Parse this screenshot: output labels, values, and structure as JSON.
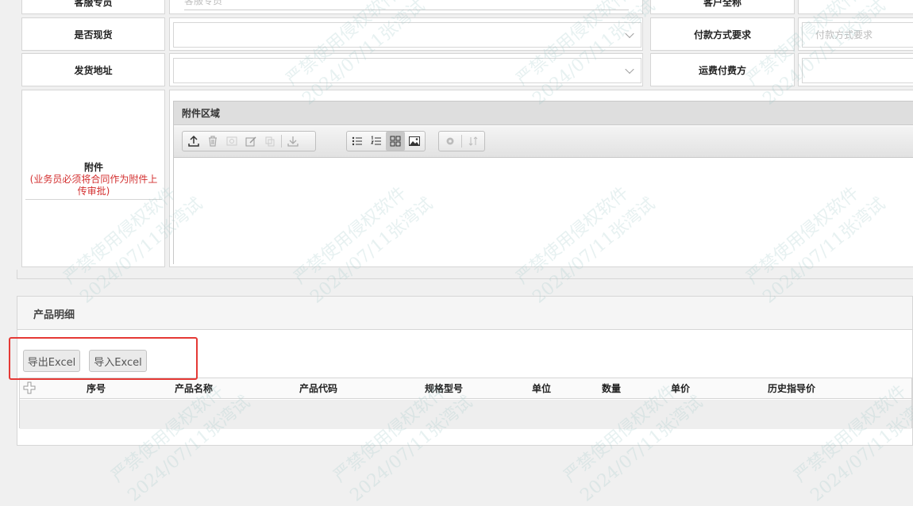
{
  "form": {
    "row0_left_label": "客服专员",
    "row0_left_placeholder": "客服专员",
    "row0_right_label": "客户全称",
    "row1_left_label": "是否现货",
    "row1_right_label": "付款方式要求",
    "row1_right_placeholder": "付款方式要求",
    "row2_left_label": "发货地址",
    "row2_right_label": "运费付费方",
    "attach_label": "附件",
    "attach_note": "(业务员必须将合同作为附件上传审批)"
  },
  "attachments": {
    "panel_title": "附件区域",
    "toolbar_icons": [
      "upload-icon",
      "trash-icon",
      "preview-icon",
      "edit-icon",
      "copy-icon",
      "download-icon",
      "bullet-list-icon",
      "numbered-list-icon",
      "grid-view-icon",
      "image-view-icon",
      "gear-icon",
      "sort-icon"
    ]
  },
  "product": {
    "section_title": "产品明细",
    "export_label": "导出Excel",
    "import_label": "导入Excel",
    "columns": [
      "序号",
      "产品名称",
      "产品代码",
      "规格型号",
      "单位",
      "数量",
      "单价",
      "历史指导价"
    ]
  },
  "watermark": {
    "line1": "严禁使用侵权软件",
    "line2": "2024/07/11张湾试"
  },
  "colors": {
    "highlight": "#e53935",
    "note_red": "#d32f2f"
  }
}
